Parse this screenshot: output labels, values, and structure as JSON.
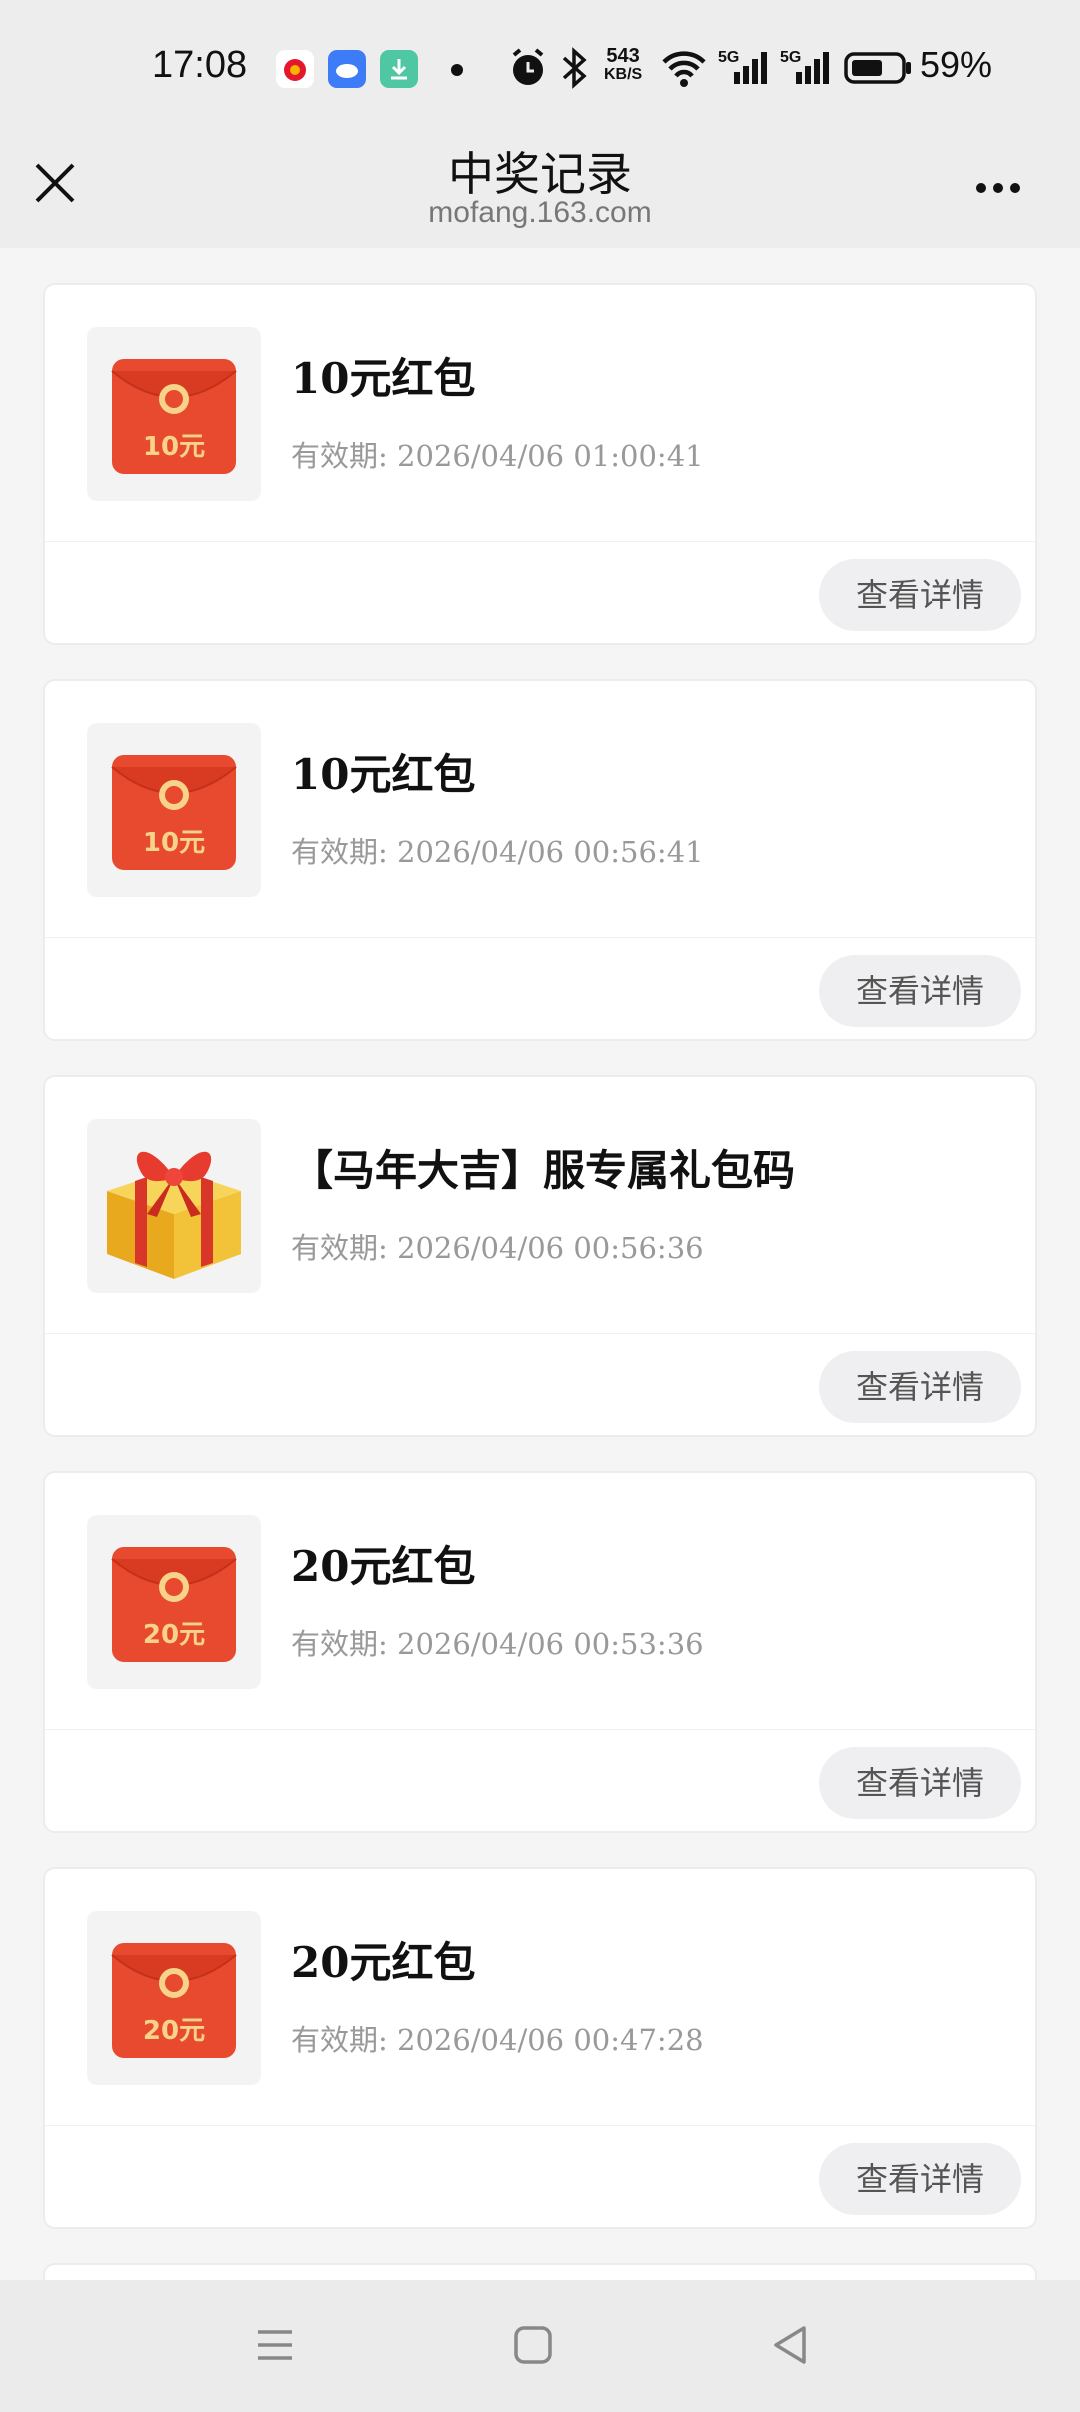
{
  "status_bar": {
    "time": "17:08",
    "net_speed": "543",
    "net_unit": "KB/S",
    "battery": "59%",
    "icons": [
      "weibo-app-icon",
      "cloud-app-icon",
      "download-app-icon",
      "alarm-icon",
      "bluetooth-icon",
      "wifi-icon",
      "5g-signal-icon",
      "5g-signal-icon",
      "battery-icon"
    ]
  },
  "header": {
    "title": "中奖记录",
    "subtitle": "mofang.163.com"
  },
  "records": [
    {
      "title": "10元红包",
      "validity": "有效期: 2026/04/06 01:00:41",
      "button": "查看详情",
      "icon": "red-envelope",
      "amount": "10元"
    },
    {
      "title": "10元红包",
      "validity": "有效期: 2026/04/06 00:56:41",
      "button": "查看详情",
      "icon": "red-envelope",
      "amount": "10元"
    },
    {
      "title": "【马年大吉】服专属礼包码",
      "validity": "有效期: 2026/04/06 00:56:36",
      "button": "查看详情",
      "icon": "gift-box",
      "amount": ""
    },
    {
      "title": "20元红包",
      "validity": "有效期: 2026/04/06 00:53:36",
      "button": "查看详情",
      "icon": "red-envelope",
      "amount": "20元"
    },
    {
      "title": "20元红包",
      "validity": "有效期: 2026/04/06 00:47:28",
      "button": "查看详情",
      "icon": "red-envelope",
      "amount": "20元"
    }
  ],
  "colors": {
    "envelope_red": "#e84a2f",
    "envelope_gold": "#f7d38a",
    "page_bg": "#f5f5f6"
  }
}
